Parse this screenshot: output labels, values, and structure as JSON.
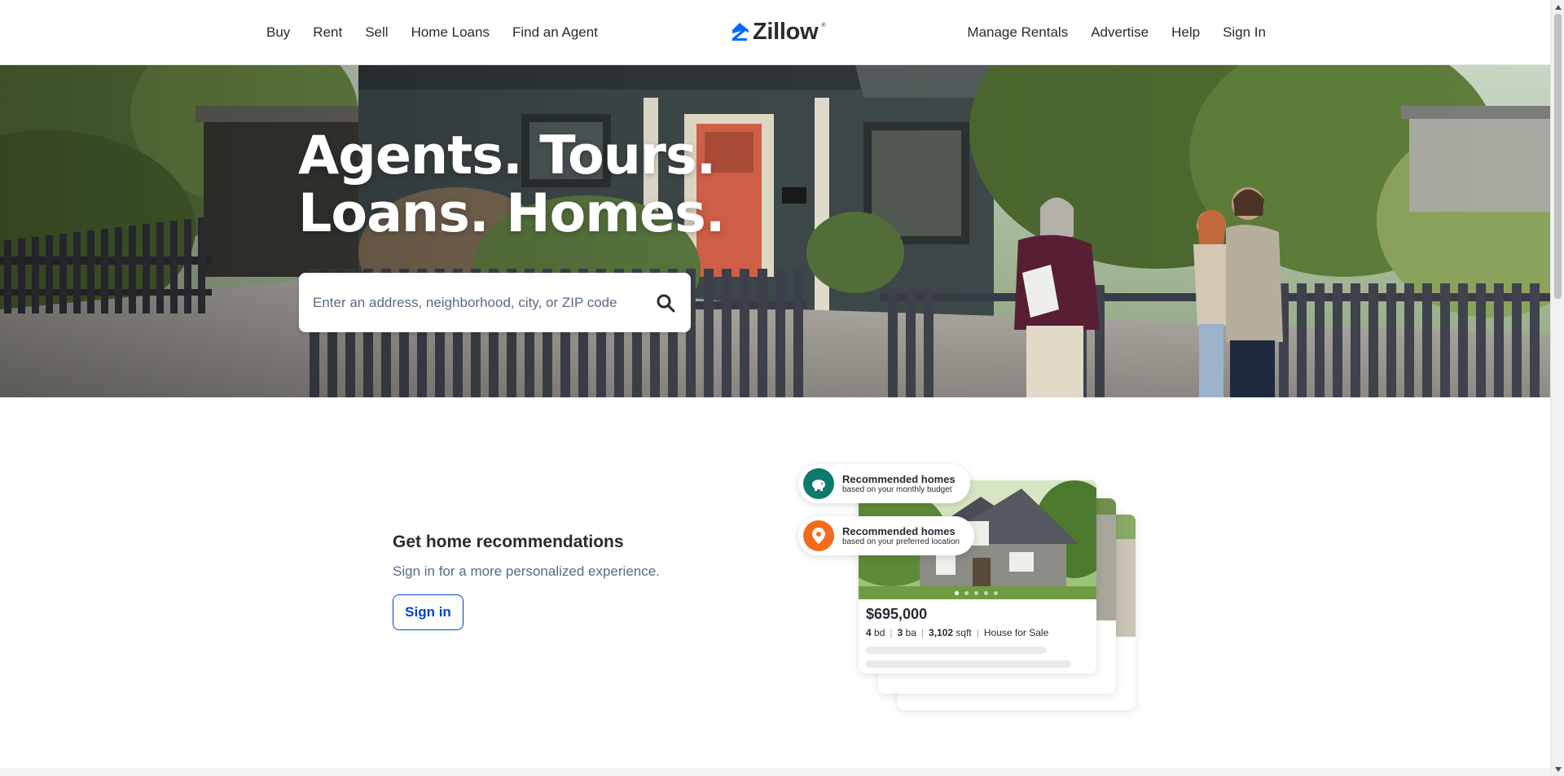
{
  "header": {
    "nav_left": [
      "Buy",
      "Rent",
      "Sell",
      "Home Loans",
      "Find an Agent"
    ],
    "logo": "Zillow",
    "nav_right": [
      "Manage Rentals",
      "Advertise",
      "Help",
      "Sign In"
    ],
    "brand_color": "#006aff"
  },
  "hero": {
    "title_line1": "Agents. Tours.",
    "title_line2": "Loans. Homes.",
    "search": {
      "placeholder": "Enter an address, neighborhood, city, or ZIP code",
      "icon": "search-icon"
    }
  },
  "recommendations": {
    "title": "Get home recommendations",
    "subtitle": "Sign in for a more personalized experience.",
    "button": "Sign in",
    "pills": [
      {
        "title": "Recommended homes",
        "subtitle": "based on your monthly budget",
        "icon": "piggy-bank-icon",
        "color": "#0d7a6b"
      },
      {
        "title": "Recommended homes",
        "subtitle": "based on your preferred location",
        "icon": "location-pin-icon",
        "color": "#f26b1d"
      }
    ],
    "card": {
      "price": "$695,000",
      "beds_value": "4",
      "beds_unit": "bd",
      "baths_value": "3",
      "baths_unit": "ba",
      "sqft_value": "3,102",
      "sqft_unit": "sqft",
      "status": "House for Sale"
    }
  },
  "colors": {
    "link_blue": "#0041d9",
    "text": "#2a2a33",
    "muted": "#596b82"
  }
}
